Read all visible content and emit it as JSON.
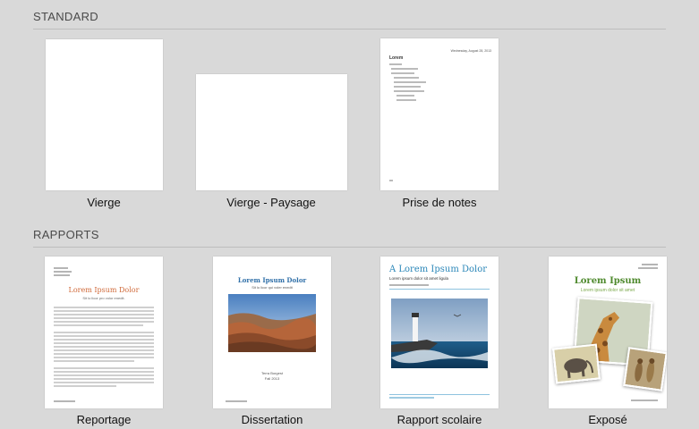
{
  "sections": {
    "standard": {
      "title": "STANDARD"
    },
    "rapports": {
      "title": "RAPPORTS"
    }
  },
  "templates": {
    "vierge": {
      "label": "Vierge"
    },
    "vierge_paysage": {
      "label": "Vierge - Paysage"
    },
    "prise_de_notes": {
      "label": "Prise de notes",
      "date": "Wednesday, August 28, 2013",
      "title": "Lorem"
    },
    "reportage": {
      "label": "Reportage",
      "title": "Lorem Ipsum Dolor",
      "subtitle": "Sit lo licor pro volor enedit."
    },
    "dissertation": {
      "label": "Dissertation",
      "title": "Lorem Ipsum Dolor",
      "subtitle": "Sit lo licor qui voler enedit",
      "author": "Terra Borgest",
      "date": "Fall 2013"
    },
    "rapport_scolaire": {
      "label": "Rapport scolaire",
      "title": "A Lorem Ipsum Dolor",
      "subtitle": "Lorem ipsum dolor sit amet ligula"
    },
    "expose": {
      "label": "Exposé",
      "title": "Lorem Ipsum",
      "subtitle": "Lorem ipsum dolor sit amet"
    }
  },
  "colors": {
    "background": "#d9d9d9",
    "reportage_title": "#d06a3a",
    "dissertation_title": "#2f6fa8",
    "rapport_title": "#2a86b8",
    "expose_title": "#4f8a2e"
  }
}
